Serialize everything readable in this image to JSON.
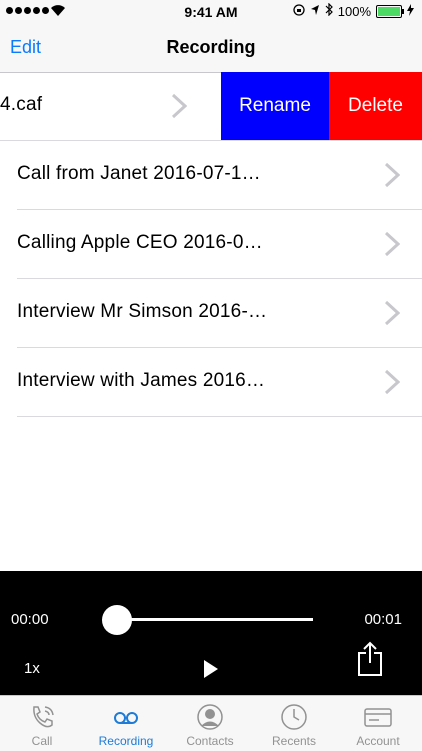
{
  "status_bar": {
    "time": "9:41 AM",
    "battery_text": "100%",
    "icons": [
      "signal-icon",
      "wifi-icon",
      "lock-rotation-icon",
      "location-icon",
      "bluetooth-icon",
      "battery-icon",
      "charging-icon"
    ]
  },
  "nav": {
    "edit_label": "Edit",
    "title": "Recording"
  },
  "recordings": [
    {
      "name": "4.caf",
      "rename_label": "Rename",
      "delete_label": "Delete"
    },
    {
      "name": "Call from Janet 2016-07-1…"
    },
    {
      "name": "Calling Apple CEO 2016-0…"
    },
    {
      "name": "Interview Mr Simson 2016-…"
    },
    {
      "name": "Interview with James 2016…"
    }
  ],
  "player": {
    "current_time": "00:00",
    "total_time": "00:01",
    "progress": 0,
    "speed": "1x"
  },
  "tabs": [
    {
      "label": "Call",
      "icon": "phone-icon",
      "active": false
    },
    {
      "label": "Recording",
      "icon": "voicemail-icon",
      "active": true
    },
    {
      "label": "Contacts",
      "icon": "contacts-icon",
      "active": false
    },
    {
      "label": "Recents",
      "icon": "recents-icon",
      "active": false
    },
    {
      "label": "Account",
      "icon": "account-icon",
      "active": false
    }
  ],
  "colors": {
    "accent": "#1e7bd6",
    "rename_bg": "#0000ff",
    "delete_bg": "#ff0000",
    "player_bg": "#000000"
  }
}
